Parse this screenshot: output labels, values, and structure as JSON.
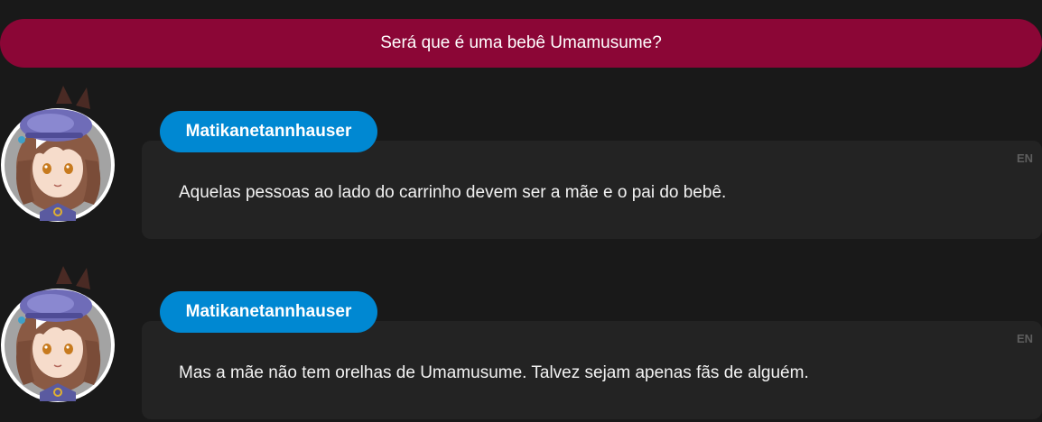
{
  "choice": {
    "text": "Será que é uma bebê Umamusume?"
  },
  "messages": [
    {
      "speaker": "Matikanetannhauser",
      "lang": "EN",
      "text": "Aquelas pessoas ao lado do carrinho devem ser a mãe e o pai do bebê."
    },
    {
      "speaker": "Matikanetannhauser",
      "lang": "EN",
      "text": "Mas a mãe não tem orelhas de Umamusume. Talvez sejam apenas fãs de alguém."
    }
  ],
  "colors": {
    "background": "#191919",
    "choice_banner": "#8b0636",
    "name_pill": "#0088d2",
    "bubble": "#232323"
  }
}
